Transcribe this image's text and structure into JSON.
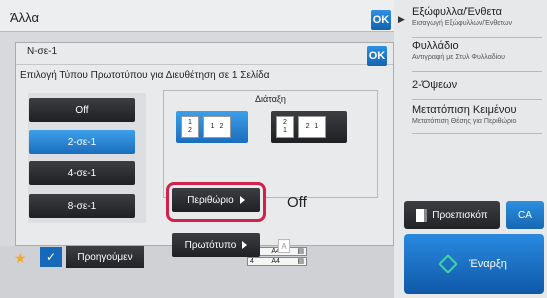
{
  "back_dialog": {
    "title": "Άλλα",
    "ok_label": "OK"
  },
  "right_panel": {
    "items": [
      {
        "title": "Εξώφυλλα/Ένθετα",
        "subtitle": "Εισαγωγή Εξώφυλλων/Ένθετων"
      },
      {
        "title": "Φυλλάδιο",
        "subtitle": "Αντιγραφή με Στυλ Φυλλαδίου"
      },
      {
        "title": "2-Όψεων",
        "subtitle": ""
      },
      {
        "title": "Μετατόπιση Κειμένου",
        "subtitle": "Μετατόπιση Θέσης για Περιθώριο"
      }
    ],
    "preview_label": "Προεπισκόπ",
    "ca_label": "CA",
    "start_label": "Έναρξη"
  },
  "bottom_bar": {
    "previous_label": "Προηγούμεν",
    "mini_rows": [
      {
        "num": "3",
        "size": "A4"
      },
      {
        "num": "4",
        "size": "A4"
      }
    ]
  },
  "dialog": {
    "title": "N-σε-1",
    "ok_label": "OK",
    "subtitle": "Επιλογή Τύπου Πρωτοτύπου για Διευθέτηση σε 1 Σελίδα",
    "modes": [
      "Off",
      "2-σε-1",
      "4-σε-1",
      "8-σε-1"
    ],
    "selected_mode": "2-σε-1",
    "layout_label": "Διάταξη",
    "layout_a": {
      "v_top": "1",
      "v_bottom": "2",
      "h_left": "1",
      "h_right": "2"
    },
    "layout_b": {
      "v_top": "2",
      "v_bottom": "1",
      "h_left": "2",
      "h_right": "1"
    },
    "margin_label": "Περιθώριο",
    "margin_value": "Off",
    "original_label": "Πρωτότυπο",
    "original_icon_letter": "A"
  },
  "colors": {
    "accent_blue": "#1b6dbd",
    "highlight_red": "#d4204a",
    "start_green": "#3fd7a0",
    "star": "#f5a623"
  }
}
